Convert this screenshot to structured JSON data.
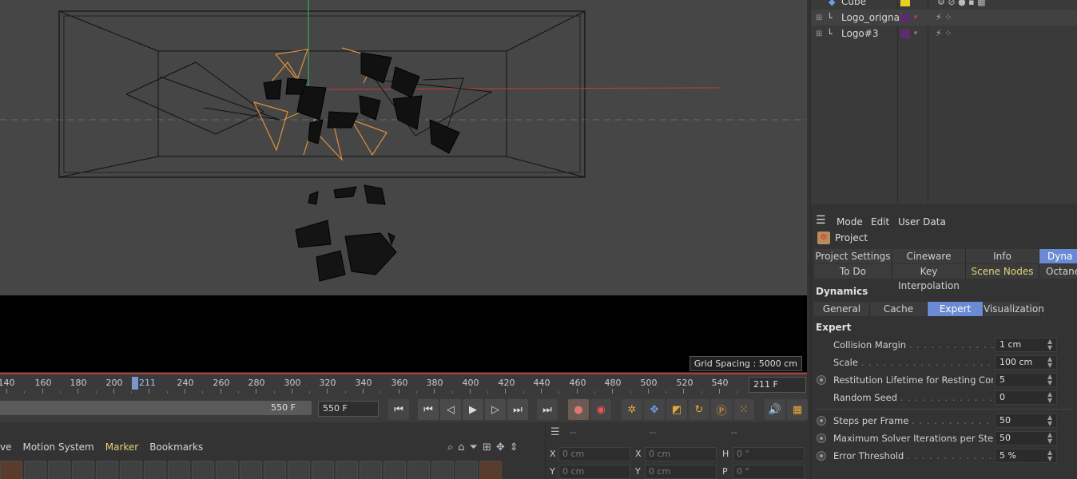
{
  "viewport": {
    "grid_spacing": "Grid Spacing : 5000 cm"
  },
  "timeline": {
    "ticks": [
      "140",
      "160",
      "180",
      "200",
      "240",
      "260",
      "280",
      "300",
      "320",
      "340",
      "360",
      "380",
      "400",
      "420",
      "440",
      "460",
      "480",
      "500",
      "520",
      "540"
    ],
    "playhead_label": "211",
    "current_frame": "211 F"
  },
  "transport": {
    "range_end": "550 F",
    "max_frame": "550 F"
  },
  "bottom_menu": {
    "items": [
      "ve",
      "Motion System",
      "Marker",
      "Bookmarks"
    ]
  },
  "coords": {
    "h1": "--",
    "h2": "--",
    "h3": "--",
    "x_label": "X",
    "x_val": "0 cm",
    "x2_label": "X",
    "x2_val": "0 cm",
    "h_label": "H",
    "h_val": "0 °",
    "y_label": "Y",
    "y_val": "0 cm",
    "y2_label": "Y",
    "y2_val": "0 cm",
    "p_label": "P",
    "p_val": "0 °"
  },
  "objects": {
    "items": [
      {
        "name": "Cube"
      },
      {
        "name": "Logo_orignal"
      },
      {
        "name": "Logo#3"
      }
    ],
    "colors": {
      "yellow": "#e6d21e",
      "purple": "#5a2e6e",
      "red": "#b93a3a"
    }
  },
  "attributes": {
    "menu": {
      "mode": "Mode",
      "edit": "Edit",
      "user_data": "User Data"
    },
    "project_title": "Project",
    "tabs_row1": [
      "Project Settings",
      "Cineware",
      "Info",
      "Dyna"
    ],
    "tabs_row2": [
      "To Do",
      "Key Interpolation",
      "Scene Nodes",
      "Octane"
    ],
    "dynamics_title": "Dynamics",
    "sub_tabs": [
      "General",
      "Cache",
      "Expert",
      "Visualization"
    ],
    "expert_title": "Expert",
    "params": [
      {
        "label": "Collision Margin",
        "value": "1 cm"
      },
      {
        "label": "Scale",
        "value": "100 cm"
      },
      {
        "label": "Restitution Lifetime for Resting Contact",
        "value": "5"
      },
      {
        "label": "Random Seed",
        "value": "0"
      },
      {
        "label": "Steps per Frame",
        "value": "50"
      },
      {
        "label": "Maximum Solver Iterations per Step",
        "value": "50"
      },
      {
        "label": "Error Threshold",
        "value": "5 %"
      }
    ]
  }
}
